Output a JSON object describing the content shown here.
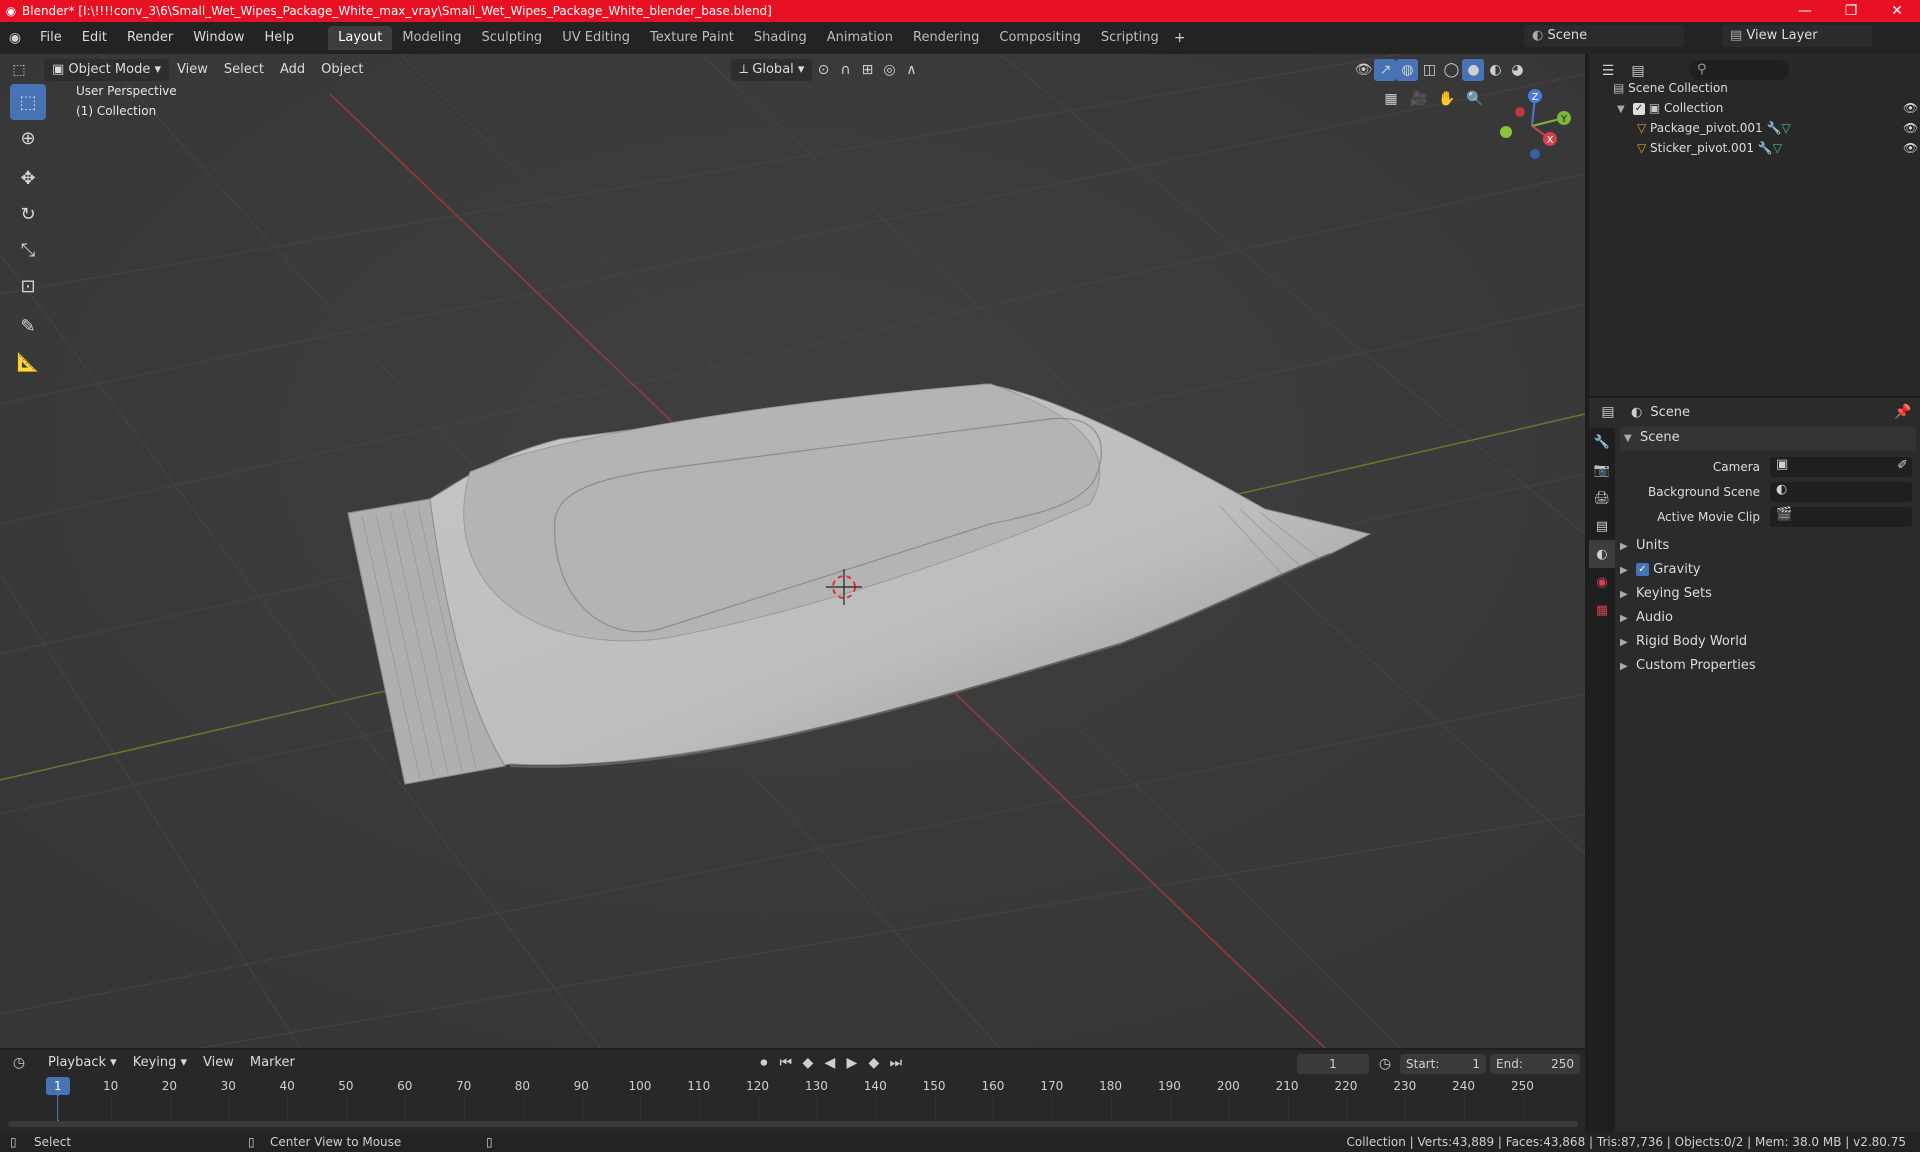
{
  "window": {
    "title": "Blender* [I:\\!!!!conv_3\\6\\Small_Wet_Wipes_Package_White_max_vray\\Small_Wet_Wipes_Package_White_blender_base.blend]",
    "minimize": "—",
    "maximize": "❐",
    "close": "✕"
  },
  "menu": [
    "File",
    "Edit",
    "Render",
    "Window",
    "Help"
  ],
  "workspaces": [
    "Layout",
    "Modeling",
    "Sculpting",
    "UV Editing",
    "Texture Paint",
    "Shading",
    "Animation",
    "Rendering",
    "Compositing",
    "Scripting"
  ],
  "active_workspace": "Layout",
  "scene_name": "Scene",
  "view_layer": "View Layer",
  "viewport": {
    "mode": "Object Mode",
    "menus": [
      "View",
      "Select",
      "Add",
      "Object"
    ],
    "transform_orientation": "Global",
    "info_line1": "User Perspective",
    "info_line2": "(1) Collection",
    "gizmo_axes": {
      "z": "Z",
      "y": "Y",
      "x": "X"
    }
  },
  "outliner": {
    "root": "Scene Collection",
    "collection": "Collection",
    "objects": [
      "Package_pivot.001",
      "Sticker_pivot.001"
    ]
  },
  "properties": {
    "header": "Scene",
    "panel_title": "Scene",
    "camera_label": "Camera",
    "background_scene_label": "Background Scene",
    "active_movie_clip_label": "Active Movie Clip",
    "subpanels": [
      "Units",
      "Gravity",
      "Keying Sets",
      "Audio",
      "Rigid Body World",
      "Custom Properties"
    ],
    "gravity_checked": true
  },
  "timeline": {
    "menus": [
      "Playback",
      "Keying",
      "View",
      "Marker"
    ],
    "current_frame": "1",
    "start_label": "Start:",
    "start": "1",
    "end_label": "End:",
    "end": "250",
    "ticks": [
      "1",
      "10",
      "20",
      "30",
      "40",
      "50",
      "60",
      "70",
      "80",
      "90",
      "100",
      "110",
      "120",
      "130",
      "140",
      "150",
      "160",
      "170",
      "180",
      "190",
      "200",
      "210",
      "220",
      "230",
      "240",
      "250"
    ]
  },
  "status": {
    "left_action": "Select",
    "middle_action": "Center View to Mouse",
    "stats": "Collection | Verts:43,889 | Faces:43,868 | Tris:87,736 | Objects:0/2 | Mem: 38.0 MB | v2.80.75"
  },
  "colors": {
    "titlebar": "#e81123",
    "accent": "#4772b3",
    "viewport_bg": "#3b3b3b",
    "x_axis": "#d4404b",
    "y_axis": "#7ab836",
    "object_orange": "#e59b3a"
  }
}
